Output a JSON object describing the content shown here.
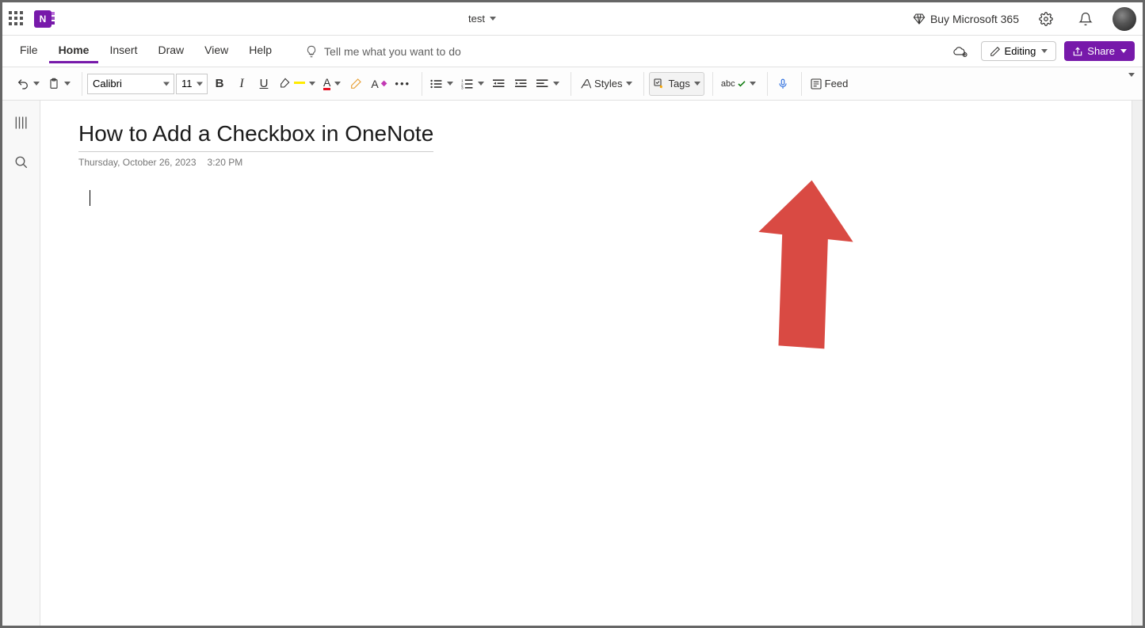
{
  "titlebar": {
    "document_name": "test",
    "buy_label": "Buy Microsoft 365"
  },
  "menubar": {
    "tabs": {
      "file": "File",
      "home": "Home",
      "insert": "Insert",
      "draw": "Draw",
      "view": "View",
      "help": "Help"
    },
    "tell_me_placeholder": "Tell me what you want to do",
    "editing_label": "Editing",
    "share_label": "Share"
  },
  "ribbon": {
    "font_name": "Calibri",
    "font_size": "11",
    "styles_label": "Styles",
    "tags_label": "Tags",
    "feed_label": "Feed"
  },
  "page": {
    "title": "How to Add a Checkbox in OneNote",
    "date": "Thursday, October 26, 2023",
    "time": "3:20 PM"
  }
}
